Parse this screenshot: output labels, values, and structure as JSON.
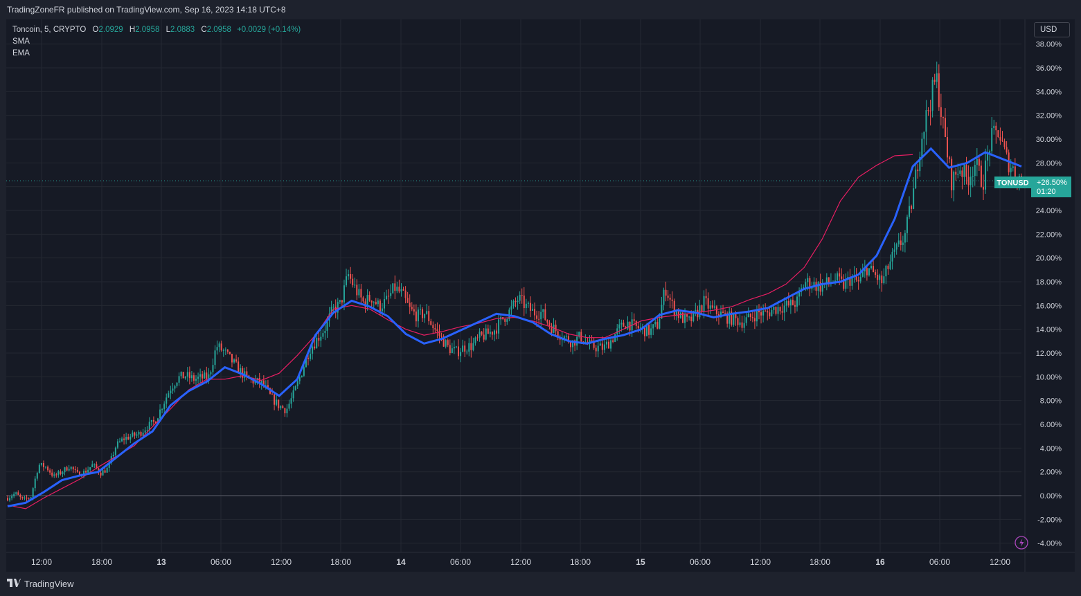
{
  "header": {
    "published": "TradingZoneFR published on TradingView.com, Sep 16, 2023 14:18 UTC+8"
  },
  "legend": {
    "symbol": "Toncoin, 5, CRYPTO",
    "o_label": "O",
    "o_value": "2.0929",
    "h_label": "H",
    "h_value": "2.0958",
    "l_label": "L",
    "l_value": "2.0883",
    "c_label": "C",
    "c_value": "2.0958",
    "change": "+0.0029 (+0.14%)",
    "indicator1": "SMA",
    "indicator2": "EMA"
  },
  "currency_button": "USD",
  "price_tag": {
    "symbol": "TONUSD",
    "value": "+26.50%",
    "countdown": "01:20"
  },
  "footer": {
    "brand": "TradingView"
  },
  "colors": {
    "background": "#161a25",
    "grid": "#242832",
    "up": "#26a69a",
    "down": "#ef5350",
    "sma": "#2962ff",
    "ema": "#e91e63",
    "text": "#d1d4dc"
  },
  "icons": {
    "logo": "tradingview-logo-icon",
    "lightning": "lightning-icon"
  },
  "chart_data": {
    "type": "line",
    "y_axis_labels": [
      "38.00%",
      "36.00%",
      "34.00%",
      "32.00%",
      "30.00%",
      "28.00%",
      "26.00%",
      "24.00%",
      "22.00%",
      "20.00%",
      "18.00%",
      "16.00%",
      "14.00%",
      "12.00%",
      "10.00%",
      "8.00%",
      "6.00%",
      "4.00%",
      "2.00%",
      "0.00%",
      "-2.00%",
      "-4.00%"
    ],
    "ylim": [
      -4.5,
      38.5
    ],
    "x_axis_labels": [
      "12:00",
      "18:00",
      "13",
      "06:00",
      "12:00",
      "18:00",
      "14",
      "06:00",
      "12:00",
      "18:00",
      "15",
      "06:00",
      "12:00",
      "18:00",
      "16",
      "06:00",
      "12:00"
    ],
    "x_label_bold": [
      false,
      false,
      true,
      false,
      false,
      false,
      true,
      false,
      false,
      false,
      true,
      false,
      false,
      false,
      true,
      false,
      false
    ],
    "last_value_percent": 26.5,
    "series": [
      {
        "name": "SMA",
        "points": [
          [
            0,
            -0.9
          ],
          [
            3,
            -0.6
          ],
          [
            6,
            0.3
          ],
          [
            9,
            1.3
          ],
          [
            12,
            1.7
          ],
          [
            15,
            2.0
          ],
          [
            18,
            3.2
          ],
          [
            21,
            4.4
          ],
          [
            24,
            5.4
          ],
          [
            27,
            7.6
          ],
          [
            30,
            8.8
          ],
          [
            33,
            9.6
          ],
          [
            36,
            10.8
          ],
          [
            39,
            10.2
          ],
          [
            42,
            9.4
          ],
          [
            45,
            8.4
          ],
          [
            48,
            9.8
          ],
          [
            51,
            13.5
          ],
          [
            54,
            15.4
          ],
          [
            57,
            16.4
          ],
          [
            60,
            15.9
          ],
          [
            63,
            15.1
          ],
          [
            66,
            13.6
          ],
          [
            69,
            12.8
          ],
          [
            72,
            13.2
          ],
          [
            75,
            13.9
          ],
          [
            78,
            14.6
          ],
          [
            81,
            15.3
          ],
          [
            84,
            15.1
          ],
          [
            87,
            14.6
          ],
          [
            90,
            13.6
          ],
          [
            93,
            13.0
          ],
          [
            96,
            12.8
          ],
          [
            99,
            13.2
          ],
          [
            102,
            13.5
          ],
          [
            105,
            14.0
          ],
          [
            108,
            15.2
          ],
          [
            111,
            15.6
          ],
          [
            114,
            15.4
          ],
          [
            117,
            15.0
          ],
          [
            120,
            15.3
          ],
          [
            123,
            15.5
          ],
          [
            126,
            15.8
          ],
          [
            129,
            16.6
          ],
          [
            132,
            17.4
          ],
          [
            135,
            17.8
          ],
          [
            138,
            18.0
          ],
          [
            141,
            18.6
          ],
          [
            144,
            20.2
          ],
          [
            147,
            23.3
          ],
          [
            150,
            27.7
          ],
          [
            153,
            29.2
          ],
          [
            156,
            27.6
          ],
          [
            159,
            28.0
          ],
          [
            162,
            28.9
          ],
          [
            165,
            28.3
          ],
          [
            168,
            27.7
          ]
        ]
      },
      {
        "name": "EMA",
        "points": [
          [
            0,
            -0.8
          ],
          [
            3,
            -1.1
          ],
          [
            6,
            -0.2
          ],
          [
            9,
            0.6
          ],
          [
            12,
            1.4
          ],
          [
            15,
            2.4
          ],
          [
            18,
            3.3
          ],
          [
            21,
            4.2
          ],
          [
            24,
            5.8
          ],
          [
            27,
            7.3
          ],
          [
            30,
            8.9
          ],
          [
            33,
            9.8
          ],
          [
            36,
            9.8
          ],
          [
            39,
            10.1
          ],
          [
            42,
            9.7
          ],
          [
            45,
            10.3
          ],
          [
            48,
            11.8
          ],
          [
            51,
            13.5
          ],
          [
            54,
            15.7
          ],
          [
            57,
            16.0
          ],
          [
            60,
            15.7
          ],
          [
            63,
            14.8
          ],
          [
            66,
            14.0
          ],
          [
            69,
            13.5
          ],
          [
            72,
            13.8
          ],
          [
            75,
            14.2
          ],
          [
            78,
            14.5
          ],
          [
            81,
            14.9
          ],
          [
            84,
            15.0
          ],
          [
            87,
            14.7
          ],
          [
            90,
            14.2
          ],
          [
            93,
            13.6
          ],
          [
            96,
            13.3
          ],
          [
            99,
            13.3
          ],
          [
            102,
            14.0
          ],
          [
            105,
            14.7
          ],
          [
            108,
            15.0
          ],
          [
            111,
            15.2
          ],
          [
            114,
            15.4
          ],
          [
            117,
            15.6
          ],
          [
            120,
            15.9
          ],
          [
            123,
            16.5
          ],
          [
            126,
            17.0
          ],
          [
            129,
            17.8
          ],
          [
            132,
            19.2
          ],
          [
            135,
            21.6
          ],
          [
            138,
            24.8
          ],
          [
            141,
            26.8
          ],
          [
            144,
            27.8
          ],
          [
            147,
            28.6
          ],
          [
            150,
            28.7
          ]
        ]
      }
    ],
    "price_path": [
      [
        0,
        -0.2
      ],
      [
        1,
        0.2
      ],
      [
        2,
        -0.4
      ],
      [
        3,
        -0.1
      ],
      [
        4,
        2.6
      ],
      [
        5,
        2.4
      ],
      [
        6,
        1.6
      ],
      [
        7,
        2.0
      ],
      [
        8,
        2.5
      ],
      [
        9,
        1.8
      ],
      [
        10,
        2.0
      ],
      [
        11,
        2.6
      ],
      [
        12,
        1.9
      ],
      [
        13,
        2.3
      ],
      [
        14,
        4.2
      ],
      [
        15,
        4.8
      ],
      [
        16,
        5.0
      ],
      [
        17,
        5.2
      ],
      [
        18,
        5.8
      ],
      [
        19,
        6.2
      ],
      [
        20,
        7.6
      ],
      [
        21,
        9.0
      ],
      [
        22,
        9.9
      ],
      [
        23,
        10.1
      ],
      [
        24,
        9.8
      ],
      [
        25,
        9.9
      ],
      [
        26,
        10.0
      ],
      [
        27,
        12.6
      ],
      [
        28,
        12.1
      ],
      [
        29,
        11.3
      ],
      [
        30,
        10.5
      ],
      [
        31,
        9.8
      ],
      [
        32,
        9.6
      ],
      [
        33,
        9.4
      ],
      [
        34,
        8.3
      ],
      [
        35,
        7.6
      ],
      [
        36,
        7.2
      ],
      [
        37,
        8.6
      ],
      [
        38,
        10.4
      ],
      [
        39,
        12.3
      ],
      [
        40,
        13.2
      ],
      [
        41,
        14.1
      ],
      [
        42,
        15.6
      ],
      [
        43,
        16.1
      ],
      [
        44,
        18.6
      ],
      [
        45,
        17.3
      ],
      [
        46,
        16.2
      ],
      [
        47,
        16.7
      ],
      [
        48,
        15.9
      ],
      [
        49,
        16.4
      ],
      [
        50,
        17.5
      ],
      [
        51,
        16.9
      ],
      [
        52,
        15.6
      ],
      [
        53,
        15.1
      ],
      [
        54,
        15.4
      ],
      [
        55,
        14.2
      ],
      [
        56,
        13.3
      ],
      [
        57,
        12.4
      ],
      [
        58,
        12.1
      ],
      [
        59,
        12.5
      ],
      [
        60,
        12.6
      ],
      [
        61,
        13.3
      ],
      [
        62,
        13.6
      ],
      [
        63,
        14.0
      ],
      [
        64,
        14.9
      ],
      [
        65,
        15.6
      ],
      [
        66,
        16.6
      ],
      [
        67,
        15.9
      ],
      [
        68,
        15.4
      ],
      [
        69,
        15.4
      ],
      [
        70,
        14.4
      ],
      [
        71,
        13.8
      ],
      [
        72,
        13.3
      ],
      [
        73,
        12.9
      ],
      [
        74,
        13.4
      ],
      [
        75,
        12.7
      ],
      [
        76,
        12.5
      ],
      [
        77,
        12.4
      ],
      [
        78,
        13.1
      ],
      [
        79,
        14.0
      ],
      [
        80,
        14.6
      ],
      [
        81,
        14.2
      ],
      [
        82,
        14.0
      ],
      [
        83,
        13.8
      ],
      [
        84,
        14.4
      ],
      [
        85,
        17.5
      ],
      [
        86,
        15.8
      ],
      [
        87,
        15.0
      ],
      [
        88,
        14.6
      ],
      [
        89,
        15.3
      ],
      [
        90,
        16.3
      ],
      [
        91,
        15.6
      ],
      [
        92,
        15.3
      ],
      [
        93,
        15.0
      ],
      [
        94,
        14.8
      ],
      [
        95,
        14.6
      ],
      [
        96,
        15.0
      ],
      [
        97,
        15.4
      ],
      [
        98,
        15.3
      ],
      [
        99,
        15.7
      ],
      [
        100,
        15.9
      ],
      [
        101,
        16.0
      ],
      [
        102,
        16.3
      ],
      [
        103,
        18.0
      ],
      [
        104,
        17.8
      ],
      [
        105,
        17.6
      ],
      [
        106,
        17.9
      ],
      [
        107,
        18.2
      ],
      [
        108,
        17.7
      ],
      [
        109,
        18.3
      ],
      [
        110,
        17.9
      ],
      [
        111,
        19.2
      ],
      [
        112,
        18.6
      ],
      [
        113,
        17.9
      ],
      [
        114,
        19.6
      ],
      [
        115,
        20.8
      ],
      [
        116,
        22.0
      ],
      [
        117,
        25.3
      ],
      [
        118,
        30.0
      ],
      [
        119,
        32.7
      ],
      [
        120,
        35.2
      ],
      [
        121,
        30.5
      ],
      [
        122,
        26.4
      ],
      [
        123,
        27.7
      ],
      [
        124,
        26.6
      ],
      [
        125,
        28.0
      ],
      [
        126,
        26.3
      ],
      [
        127,
        29.9
      ],
      [
        128,
        30.7
      ],
      [
        129,
        28.4
      ],
      [
        130,
        27.4
      ],
      [
        131,
        26.5
      ]
    ]
  }
}
